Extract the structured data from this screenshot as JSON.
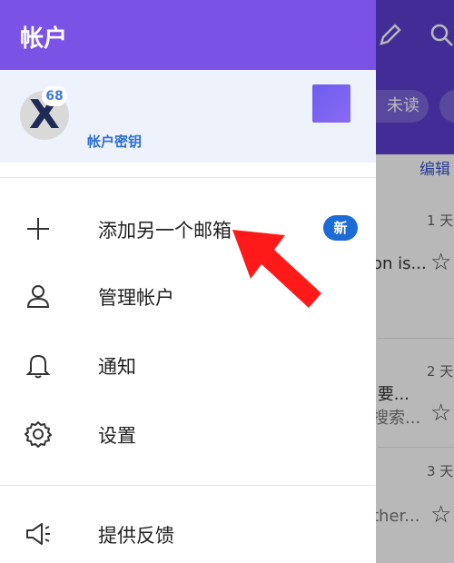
{
  "drawer": {
    "title": "帐户",
    "account": {
      "avatar_letter": "X",
      "unread_badge": "68",
      "link_label": "帐户密钥"
    },
    "menu": [
      {
        "label": "添加另一个邮箱",
        "icon": "plus-icon",
        "badge": "新"
      },
      {
        "label": "管理帐户",
        "icon": "person-icon"
      },
      {
        "label": "通知",
        "icon": "bell-icon"
      },
      {
        "label": "设置",
        "icon": "gear-icon"
      },
      {
        "label": "提供反馈",
        "icon": "megaphone-icon"
      }
    ]
  },
  "background": {
    "filter_pill": "未读",
    "edit_label": "编辑",
    "items": [
      {
        "time": "1 天",
        "snippet": "on is..."
      },
      {
        "time": "2 天",
        "snippet": "·要...",
        "snippet2": "搜索..."
      },
      {
        "time": "3 天",
        "snippet": "ther..."
      }
    ]
  },
  "colors": {
    "drawer_header": "#7b52e6",
    "app_header": "#5b3fcf",
    "account_bg": "#eef3fb",
    "new_badge": "#1c6bd6",
    "arrow": "#ff1a1a"
  }
}
